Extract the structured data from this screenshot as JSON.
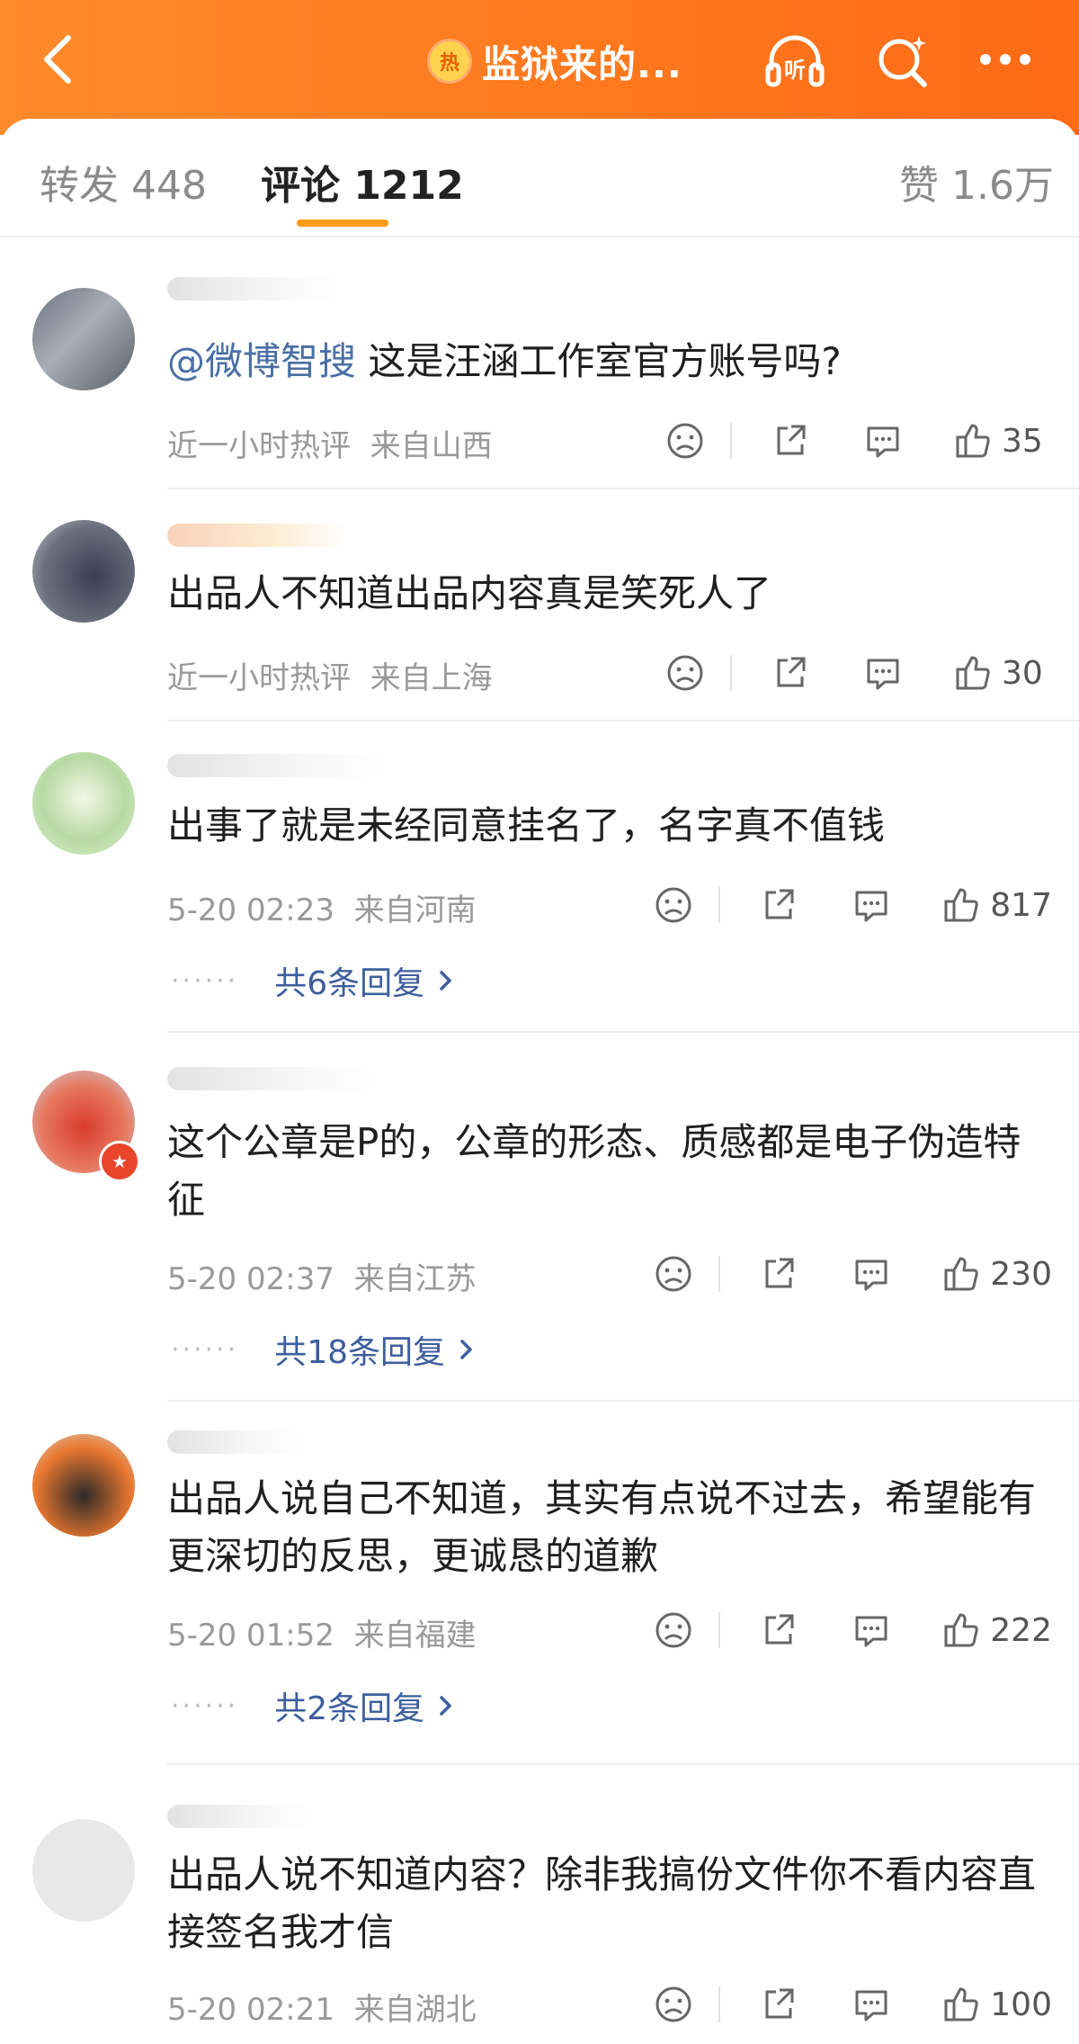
{
  "header": {
    "badge": "热",
    "title": "监狱来的..."
  },
  "tabs": {
    "repost": "转发 448",
    "comments": "评论 1212",
    "likes": "赞 1.6万"
  },
  "comments": [
    {
      "mention": "@微博智搜",
      "text": " 这是汪涵工作室官方账号吗?",
      "time": "近一小时热评",
      "location": "来自山西",
      "likes": "35"
    },
    {
      "text": "出品人不知道出品内容真是笑死人了",
      "time": "近一小时热评",
      "location": "来自上海",
      "likes": "30"
    },
    {
      "text": "出事了就是未经同意挂名了，名字真不值钱",
      "time": "5-20 02:23",
      "location": "来自河南",
      "likes": "817",
      "replies": "共6条回复"
    },
    {
      "text": "这个公章是P的，公章的形态、质感都是电子伪造特征",
      "time": "5-20 02:37",
      "location": "来自江苏",
      "likes": "230",
      "replies": "共18条回复"
    },
    {
      "text": "出品人说自己不知道，其实有点说不过去，希望能有更深切的反思，更诚恳的道歉",
      "time": "5-20 01:52",
      "location": "来自福建",
      "likes": "222",
      "replies": "共2条回复"
    },
    {
      "text": "出品人说不知道内容？除非我搞份文件你不看内容直接签名我才信",
      "time": "5-20 02:21",
      "location": "来自湖北",
      "likes": "100"
    }
  ],
  "replies_dots": "······",
  "colors": {
    "header": "#ff7a1f",
    "accent_underline": "#ff9a15",
    "link": "#3d5e9e"
  }
}
